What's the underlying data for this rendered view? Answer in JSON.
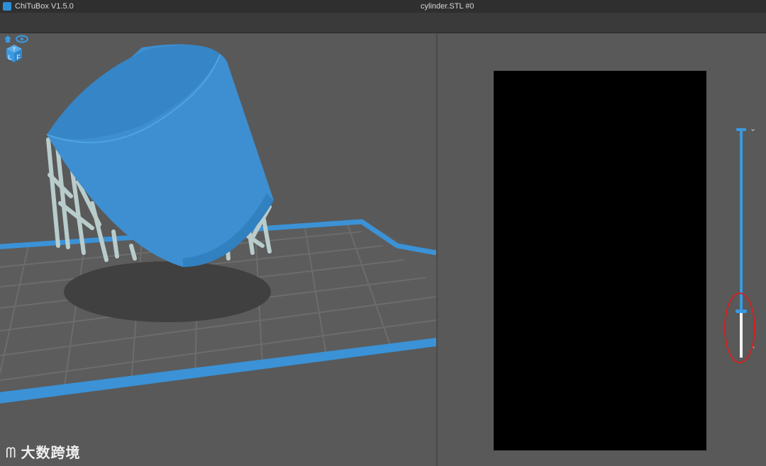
{
  "titlebar": {
    "app_name": "ChiTuBox V1.5.0",
    "file_name": "cylinder.STL #0"
  },
  "viewport": {
    "view_cube_faces": {
      "top": "T",
      "left": "L",
      "front": "F"
    },
    "icons": [
      "home-icon",
      "eye-icon"
    ]
  },
  "preview": {
    "slider_up_glyph": "⌄",
    "slider_down_glyph": "⌃",
    "current_layer_fraction": 0.24
  },
  "watermark": {
    "logo": "ᗰ",
    "text": "大数跨境"
  },
  "colors": {
    "accent": "#3b99e0",
    "model": "#3d8fd1",
    "highlight": "#d62020",
    "grid": "#6a6a6a"
  }
}
